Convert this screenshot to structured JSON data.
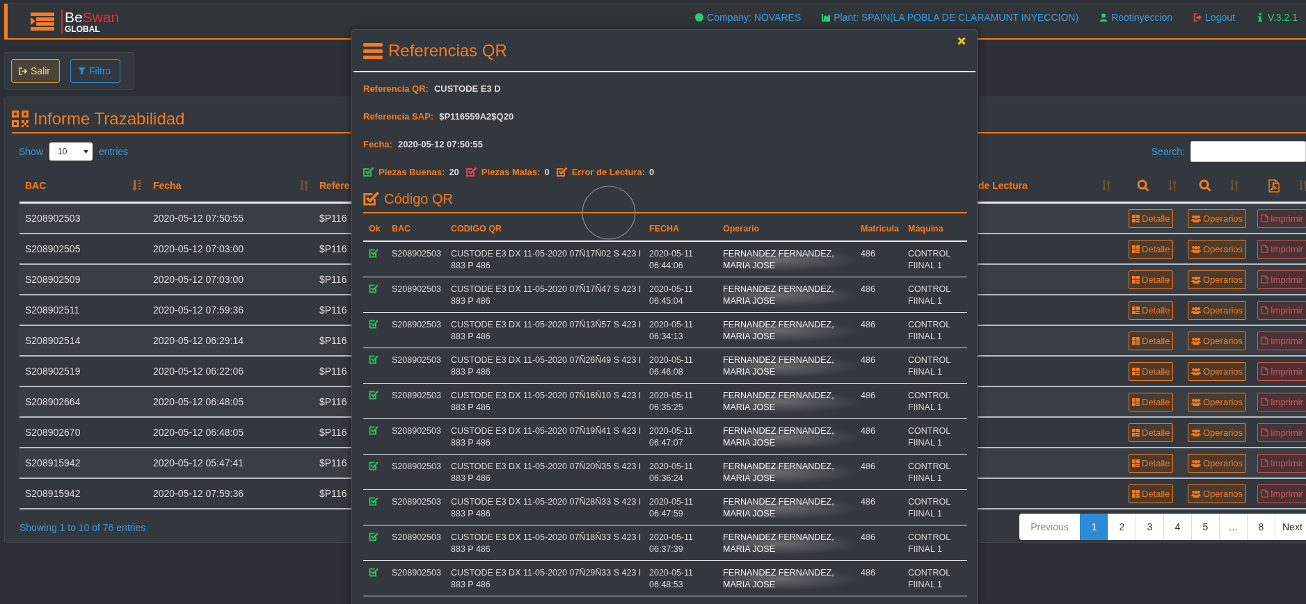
{
  "header": {
    "logo": [
      "Be",
      "Swan",
      "GLOBAL"
    ],
    "nav": [
      {
        "kind": "link",
        "label": "Company: NOVARES",
        "color": "#2ecc71"
      },
      {
        "kind": "link",
        "label": "Plant: SPAIN(LA POBLA DE CLARAMUNT INYECCION)",
        "color": "#2ecc71"
      },
      {
        "kind": "link",
        "label": "Rootinyeccion",
        "color": "#2ecc71"
      },
      {
        "kind": "link",
        "label": "Logout",
        "color": "#e74c3c"
      },
      {
        "kind": "version",
        "label": "V.3.2.1",
        "color": "#2ecc71"
      }
    ]
  },
  "toolbar": {
    "buttons": [
      {
        "kind": "exit",
        "label": "Salir"
      },
      {
        "kind": "filter",
        "label": "Filtro"
      }
    ]
  },
  "report": {
    "title": "Informe Trazabilidad",
    "show_label": "Show",
    "page_size": "10",
    "entries_label": "entries",
    "search_label": "Search:",
    "columns": [
      {
        "label": "BAC",
        "sorted": true
      },
      {
        "label": "Fecha",
        "sorted": false
      },
      {
        "label": "de Lectura",
        "sorted": false
      }
    ],
    "ref_column_label": "Refere",
    "rows": [
      {
        "bac": "S208902503",
        "fecha": "2020-05-12 07:50:55",
        "ref": "$P116",
        "detalle": "Detalle",
        "operarios": "Operarios",
        "imprimir": "Imprimir"
      },
      {
        "bac": "S208902505",
        "fecha": "2020-05-12 07:03:00",
        "ref": "$P116",
        "detalle": "Detalle",
        "operarios": "Operarios",
        "imprimir": "Imprimir"
      },
      {
        "bac": "S208902509",
        "fecha": "2020-05-12 07:03:00",
        "ref": "$P116",
        "detalle": "Detalle",
        "operarios": "Operarios",
        "imprimir": "Imprimir"
      },
      {
        "bac": "S208902511",
        "fecha": "2020-05-12 07:59:36",
        "ref": "$P116",
        "detalle": "Detalle",
        "operarios": "Operarios",
        "imprimir": "Imprimir"
      },
      {
        "bac": "S208902514",
        "fecha": "2020-05-12 06:29:14",
        "ref": "$P116",
        "detalle": "Detalle",
        "operarios": "Operarios",
        "imprimir": "Imprimir"
      },
      {
        "bac": "S208902519",
        "fecha": "2020-05-12 06:22:06",
        "ref": "$P116",
        "detalle": "Detalle",
        "operarios": "Operarios",
        "imprimir": "Imprimir"
      },
      {
        "bac": "S208902664",
        "fecha": "2020-05-12 06:48:05",
        "ref": "$P116",
        "detalle": "Detalle",
        "operarios": "Operarios",
        "imprimir": "Imprimir"
      },
      {
        "bac": "S208902670",
        "fecha": "2020-05-12 06:48:05",
        "ref": "$P116",
        "detalle": "Detalle",
        "operarios": "Operarios",
        "imprimir": "Imprimir"
      },
      {
        "bac": "S208915942",
        "fecha": "2020-05-12 05:47:41",
        "ref": "$P116",
        "detalle": "Detalle",
        "operarios": "Operarios",
        "imprimir": "Imprimir"
      },
      {
        "bac": "S208915942",
        "fecha": "2020-05-12 07:59:36",
        "ref": "$P116",
        "detalle": "Detalle",
        "operarios": "Operarios",
        "imprimir": "Imprimir"
      }
    ],
    "info": "Showing 1 to 10 of 76 entries",
    "pagination": {
      "previous": {
        "label": "Previous",
        "disabled": true
      },
      "pages": [
        {
          "label": "1",
          "selected": true
        },
        {
          "label": "2",
          "selected": false
        },
        {
          "label": "3",
          "selected": false
        },
        {
          "label": "4",
          "selected": false
        },
        {
          "label": "5",
          "selected": false
        },
        {
          "label": "…",
          "selected": false
        },
        {
          "label": "8",
          "selected": false
        }
      ],
      "next": {
        "label": "Next",
        "disabled": false
      }
    }
  },
  "modal": {
    "title": "Referencias QR",
    "fields": [
      {
        "label": "Referencia QR:",
        "value": "CUSTODE E3 D"
      },
      {
        "label": "Referencia SAP:",
        "value": "$P116559A2$Q20"
      },
      {
        "label": "Fecha:",
        "value": "2020-05-12 07:50:55"
      }
    ],
    "stats": [
      {
        "label": "Piezas Buenas:",
        "value": "20",
        "color": "#2eb85c"
      },
      {
        "label": "Piezas Malas:",
        "value": "0",
        "color": "#e0475a"
      },
      {
        "label": "Error de Lectura:",
        "value": "0",
        "color": "#f47b20"
      }
    ],
    "section_title": "Código QR",
    "columns": [
      "Ok",
      "BAC",
      "CODIGO QR",
      "FECHA",
      "Operario",
      "Matricula",
      "Máquina"
    ],
    "rows": [
      {
        "ok": true,
        "bac": "S208902503",
        "codigo": "CUSTODE E3 DX 11-05-2020 07Ñ17Ñ02 S 423 I 883 P 486",
        "fecha": "2020-05-11 06:44:06",
        "operario": "FERNANDEZ FERNANDEZ, MARIA JOSE",
        "matricula": "486",
        "maquina": "CONTROL FIINAL 1"
      },
      {
        "ok": true,
        "bac": "S208902503",
        "codigo": "CUSTODE E3 DX 11-05-2020 07Ñ17Ñ47 S 423 I 883 P 486",
        "fecha": "2020-05-11 06:45:04",
        "operario": "FERNANDEZ FERNANDEZ, MARIA JOSE",
        "matricula": "486",
        "maquina": "CONTROL FIINAL 1"
      },
      {
        "ok": true,
        "bac": "S208902503",
        "codigo": "CUSTODE E3 DX 11-05-2020 07Ñ13Ñ57 S 423 I 883 P 486",
        "fecha": "2020-05-11 06:34:13",
        "operario": "FERNANDEZ FERNANDEZ, MARIA JOSE",
        "matricula": "486",
        "maquina": "CONTROL FIINAL 1"
      },
      {
        "ok": true,
        "bac": "S208902503",
        "codigo": "CUSTODE E3 DX 11-05-2020 07Ñ26Ñ49 S 423 I 883 P 486",
        "fecha": "2020-05-11 06:46:08",
        "operario": "FERNANDEZ FERNANDEZ, MARIA JOSE",
        "matricula": "486",
        "maquina": "CONTROL FIINAL 1"
      },
      {
        "ok": true,
        "bac": "S208902503",
        "codigo": "CUSTODE E3 DX 11-05-2020 07Ñ16Ñ10 S 423 I 883 P 486",
        "fecha": "2020-05-11 06:35:25",
        "operario": "FERNANDEZ FERNANDEZ, MARIA JOSE",
        "matricula": "486",
        "maquina": "CONTROL FIINAL 1"
      },
      {
        "ok": true,
        "bac": "S208902503",
        "codigo": "CUSTODE E3 DX 11-05-2020 07Ñ19Ñ41 S 423 I 883 P 486",
        "fecha": "2020-05-11 06:47:07",
        "operario": "FERNANDEZ FERNANDEZ, MARIA JOSE",
        "matricula": "486",
        "maquina": "CONTROL FIINAL 1"
      },
      {
        "ok": true,
        "bac": "S208902503",
        "codigo": "CUSTODE E3 DX 11-05-2020 07Ñ20Ñ35 S 423 I 883 P 486",
        "fecha": "2020-05-11 06:36:24",
        "operario": "FERNANDEZ FERNANDEZ, MARIA JOSE",
        "matricula": "486",
        "maquina": "CONTROL FIINAL 1"
      },
      {
        "ok": true,
        "bac": "S208902503",
        "codigo": "CUSTODE E3 DX 11-05-2020 07Ñ28Ñ33 S 423 I 883 P 486",
        "fecha": "2020-05-11 06:47:59",
        "operario": "FERNANDEZ FERNANDEZ, MARIA JOSE",
        "matricula": "486",
        "maquina": "CONTROL FIINAL 1"
      },
      {
        "ok": true,
        "bac": "S208902503",
        "codigo": "CUSTODE E3 DX 11-05-2020 07Ñ18Ñ33 S 423 I 883 P 486",
        "fecha": "2020-05-11 06:37:39",
        "operario": "FERNANDEZ FERNANDEZ, MARIA JOSE",
        "matricula": "486",
        "maquina": "CONTROL FIINAL 1"
      },
      {
        "ok": true,
        "bac": "S208902503",
        "codigo": "CUSTODE E3 DX 11-05-2020 07Ñ29Ñ33 S 423 I 883 P 486",
        "fecha": "2020-05-11 06:48:53",
        "operario": "FERNANDEZ FERNANDEZ, MARIA JOSE",
        "matricula": "486",
        "maquina": "CONTROL FIINAL 1"
      }
    ]
  }
}
